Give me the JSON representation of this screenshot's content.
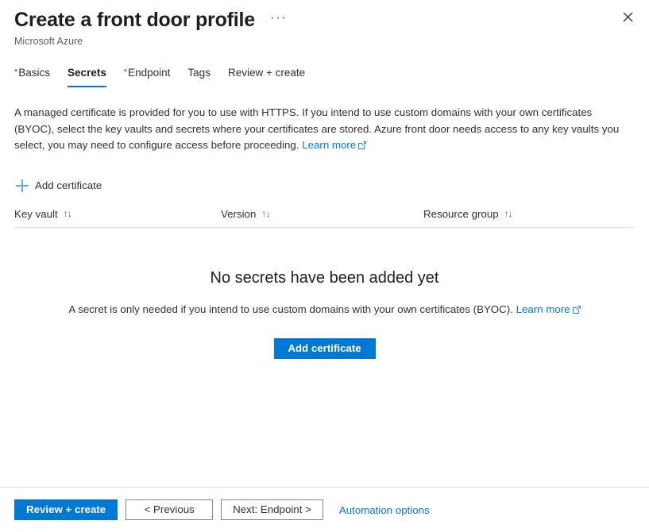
{
  "header": {
    "title": "Create a front door profile",
    "subtitle": "Microsoft Azure",
    "ellipsis": "···",
    "close_label": "Close"
  },
  "tabs": [
    {
      "label": "Basics",
      "required": true,
      "active": false
    },
    {
      "label": "Secrets",
      "required": false,
      "active": true
    },
    {
      "label": "Endpoint",
      "required": true,
      "active": false
    },
    {
      "label": "Tags",
      "required": false,
      "active": false
    },
    {
      "label": "Review + create",
      "required": false,
      "active": false
    }
  ],
  "description": {
    "text": "A managed certificate is provided for you to use with HTTPS. If you intend to use custom domains with your own certificates (BYOC), select the key vaults and secrets where your certificates are stored. Azure front door needs access to any key vaults you select, you may need to configure access before proceeding.",
    "link_label": "Learn more"
  },
  "commandbar": {
    "add_certificate_label": "Add certificate",
    "plus_icon": "plus-icon"
  },
  "table": {
    "columns": [
      {
        "label": "Key vault",
        "sort_icon": "↑↓"
      },
      {
        "label": "Version",
        "sort_icon": "↑↓"
      },
      {
        "label": "Resource group",
        "sort_icon": "↑↓"
      }
    ],
    "rows": []
  },
  "empty_state": {
    "title": "No secrets have been added yet",
    "subtitle": "A secret is only needed if you intend to use custom domains with your own certificates (BYOC).",
    "link_label": "Learn more",
    "button_label": "Add certificate"
  },
  "footer": {
    "review_create_label": "Review + create",
    "previous_label": "< Previous",
    "next_label": "Next: Endpoint >",
    "automation_label": "Automation options"
  },
  "colors": {
    "accent": "#0078d4",
    "link": "#0078d4",
    "required_asterisk": "#a4262c",
    "plus_icon": "#6cabe0",
    "border": "#e1dfdd",
    "text": "#323130"
  }
}
